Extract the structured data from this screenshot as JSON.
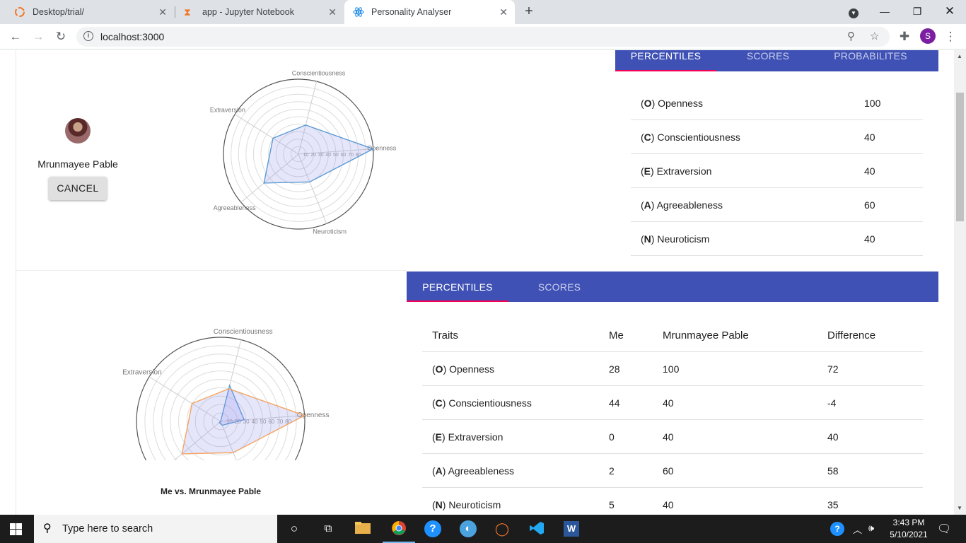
{
  "browser": {
    "tabs": [
      {
        "title": "Desktop/trial/",
        "icon": "jupyter-icon"
      },
      {
        "title": "app - Jupyter Notebook",
        "icon": "hourglass-icon"
      },
      {
        "title": "Personality Analyser",
        "icon": "react-icon",
        "active": true
      }
    ],
    "url": "localhost:3000",
    "profile_initial": "S"
  },
  "profile": {
    "name": "Mrunmayee Pable",
    "cancel_label": "CANCEL"
  },
  "top_tabs": [
    "PERCENTILES",
    "SCORES",
    "PROBABILITES"
  ],
  "top_table": [
    {
      "letter": "O",
      "trait": "Openness",
      "value": "100"
    },
    {
      "letter": "C",
      "trait": "Conscientiousness",
      "value": "40"
    },
    {
      "letter": "E",
      "trait": "Extraversion",
      "value": "40"
    },
    {
      "letter": "A",
      "trait": "Agreeableness",
      "value": "60"
    },
    {
      "letter": "N",
      "trait": "Neuroticism",
      "value": "40"
    }
  ],
  "bottom_tabs": [
    "PERCENTILES",
    "SCORES"
  ],
  "compare_table": {
    "headers": [
      "Traits",
      "Me",
      "Mrunmayee Pable",
      "Difference"
    ],
    "rows": [
      {
        "letter": "O",
        "trait": "Openness",
        "me": "28",
        "other": "100",
        "diff": "72"
      },
      {
        "letter": "C",
        "trait": "Conscientiousness",
        "me": "44",
        "other": "40",
        "diff": "-4"
      },
      {
        "letter": "E",
        "trait": "Extraversion",
        "me": "0",
        "other": "40",
        "diff": "40"
      },
      {
        "letter": "A",
        "trait": "Agreeableness",
        "me": "2",
        "other": "60",
        "diff": "58"
      },
      {
        "letter": "N",
        "trait": "Neuroticism",
        "me": "5",
        "other": "40",
        "diff": "35"
      }
    ]
  },
  "chart_caption": "Me vs. Mrunmayee Pable",
  "chart_data": [
    {
      "type": "radar",
      "axes": [
        "Openness",
        "Conscientiousness",
        "Extraversion",
        "Agreeableness",
        "Neuroticism"
      ],
      "ticks": [
        "10",
        "20",
        "30",
        "40",
        "50",
        "60",
        "70",
        "80"
      ],
      "range": [
        0,
        100
      ],
      "series": [
        {
          "values": [
            100,
            40,
            40,
            60,
            40
          ],
          "color": "#5b9bd5"
        }
      ]
    },
    {
      "type": "radar",
      "axes": [
        "Openness",
        "Conscientiousness",
        "Extraversion",
        "Agreeableness",
        "Neuroticism"
      ],
      "ticks": [
        "10",
        "20",
        "30",
        "40",
        "50",
        "60",
        "70",
        "80"
      ],
      "range": [
        0,
        100
      ],
      "title": "Me vs. Mrunmayee Pable",
      "series": [
        {
          "values": [
            28,
            44,
            0,
            2,
            5
          ],
          "color": "#5b9bd5"
        },
        {
          "values": [
            100,
            40,
            40,
            60,
            40
          ],
          "color": "#f4a460"
        }
      ]
    }
  ],
  "taskbar": {
    "search_placeholder": "Type here to search",
    "time": "3:43 PM",
    "date": "5/10/2021"
  }
}
